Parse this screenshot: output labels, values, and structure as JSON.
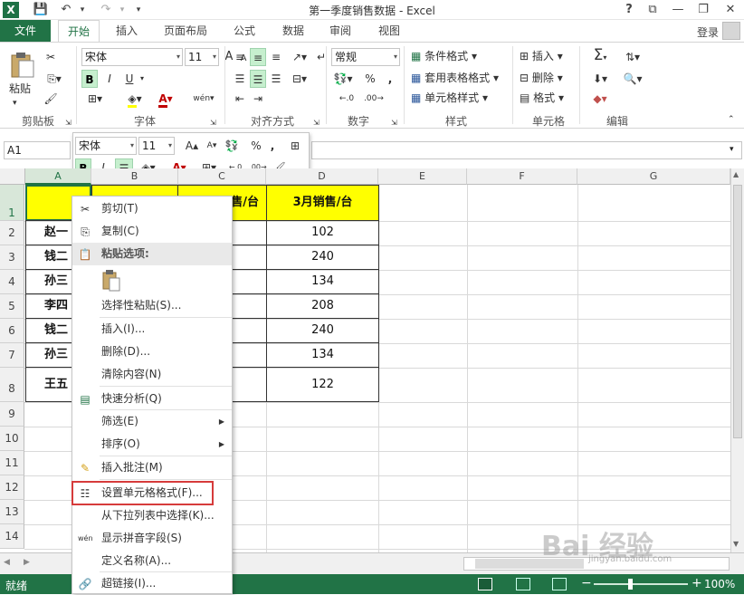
{
  "window": {
    "title": "第一季度销售数据 - Excel",
    "help": "?",
    "minimize": "—",
    "restore": "❐",
    "close": "✕",
    "ribbon_display": "⧉"
  },
  "qat": {
    "save": "💾",
    "undo": "↶",
    "redo": "↷",
    "customize": "▾"
  },
  "tabs": [
    {
      "label": "文件"
    },
    {
      "label": "开始"
    },
    {
      "label": "插入"
    },
    {
      "label": "页面布局"
    },
    {
      "label": "公式"
    },
    {
      "label": "数据"
    },
    {
      "label": "审阅"
    },
    {
      "label": "视图"
    }
  ],
  "user": {
    "login": "登录"
  },
  "ribbon": {
    "clipboard": {
      "label": "剪贴板",
      "paste": "粘贴"
    },
    "font": {
      "label": "字体",
      "name": "宋体",
      "size": "11",
      "bold": "B",
      "italic": "I",
      "underline": "U",
      "grow": "A",
      "shrink": "A",
      "wen": "wén"
    },
    "alignment": {
      "label": "对齐方式"
    },
    "number": {
      "label": "数字",
      "format": "常规",
      "percent": "%",
      "comma": ","
    },
    "styles": {
      "label": "样式",
      "conditional": "条件格式",
      "table": "套用表格格式",
      "cell_styles": "单元格样式"
    },
    "cells": {
      "label": "单元格",
      "insert": "插入",
      "delete": "删除",
      "format": "格式"
    },
    "editing": {
      "label": "编辑",
      "sum": "Σ"
    }
  },
  "namebox": "A1",
  "mini_toolbar": {
    "font": "宋体",
    "size": "11",
    "bold": "B",
    "italic": "I",
    "percent": "%",
    "comma": ","
  },
  "columns": [
    "A",
    "B",
    "C",
    "D",
    "E",
    "F",
    "G"
  ],
  "rows": [
    "1",
    "2",
    "3",
    "4",
    "5",
    "6",
    "7",
    "8",
    "9",
    "10",
    "11",
    "12",
    "13",
    "14"
  ],
  "table": {
    "header_c": "售/台",
    "header_d": "3月销售/台",
    "names": [
      "赵一",
      "钱二",
      "孙三",
      "李四",
      "钱二",
      "孙三",
      "王五"
    ],
    "d_values": [
      "102",
      "240",
      "134",
      "208",
      "240",
      "134",
      "122"
    ]
  },
  "context_menu": {
    "cut": "剪切(T)",
    "copy": "复制(C)",
    "paste_options": "粘贴选项:",
    "paste_special": "选择性粘贴(S)...",
    "insert": "插入(I)...",
    "delete": "删除(D)...",
    "clear": "清除内容(N)",
    "quick_analysis": "快速分析(Q)",
    "filter": "筛选(E)",
    "sort": "排序(O)",
    "comment": "插入批注(M)",
    "format_cells": "设置单元格格式(F)...",
    "pick_list": "从下拉列表中选择(K)...",
    "phonetic": "显示拼音字段(S)",
    "define_name": "定义名称(A)...",
    "hyperlink": "超链接(I)..."
  },
  "status": {
    "ready": "就绪",
    "zoom": "100%",
    "zoom_minus": "−",
    "zoom_plus": "+"
  },
  "watermark": {
    "logo": "Bai 经验",
    "url": "jingyan.baidu.com"
  },
  "colors": {
    "excel_green": "#217346",
    "yellow": "#ffff00",
    "highlight_red": "#d63b3b"
  }
}
